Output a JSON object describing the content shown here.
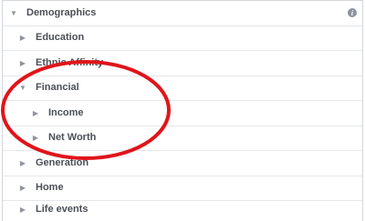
{
  "panel": {
    "title": "Demographics",
    "info_icon": "info-icon",
    "items": [
      {
        "label": "Education",
        "expanded": false
      },
      {
        "label": "Ethnic Affinity",
        "expanded": false
      },
      {
        "label": "Financial",
        "expanded": true
      },
      {
        "label": "Income",
        "expanded": false
      },
      {
        "label": "Net Worth",
        "expanded": false
      },
      {
        "label": "Generation",
        "expanded": false
      },
      {
        "label": "Home",
        "expanded": false
      },
      {
        "label": "Life events",
        "expanded": false
      }
    ]
  },
  "annotation": {
    "color": "#e0151b"
  }
}
